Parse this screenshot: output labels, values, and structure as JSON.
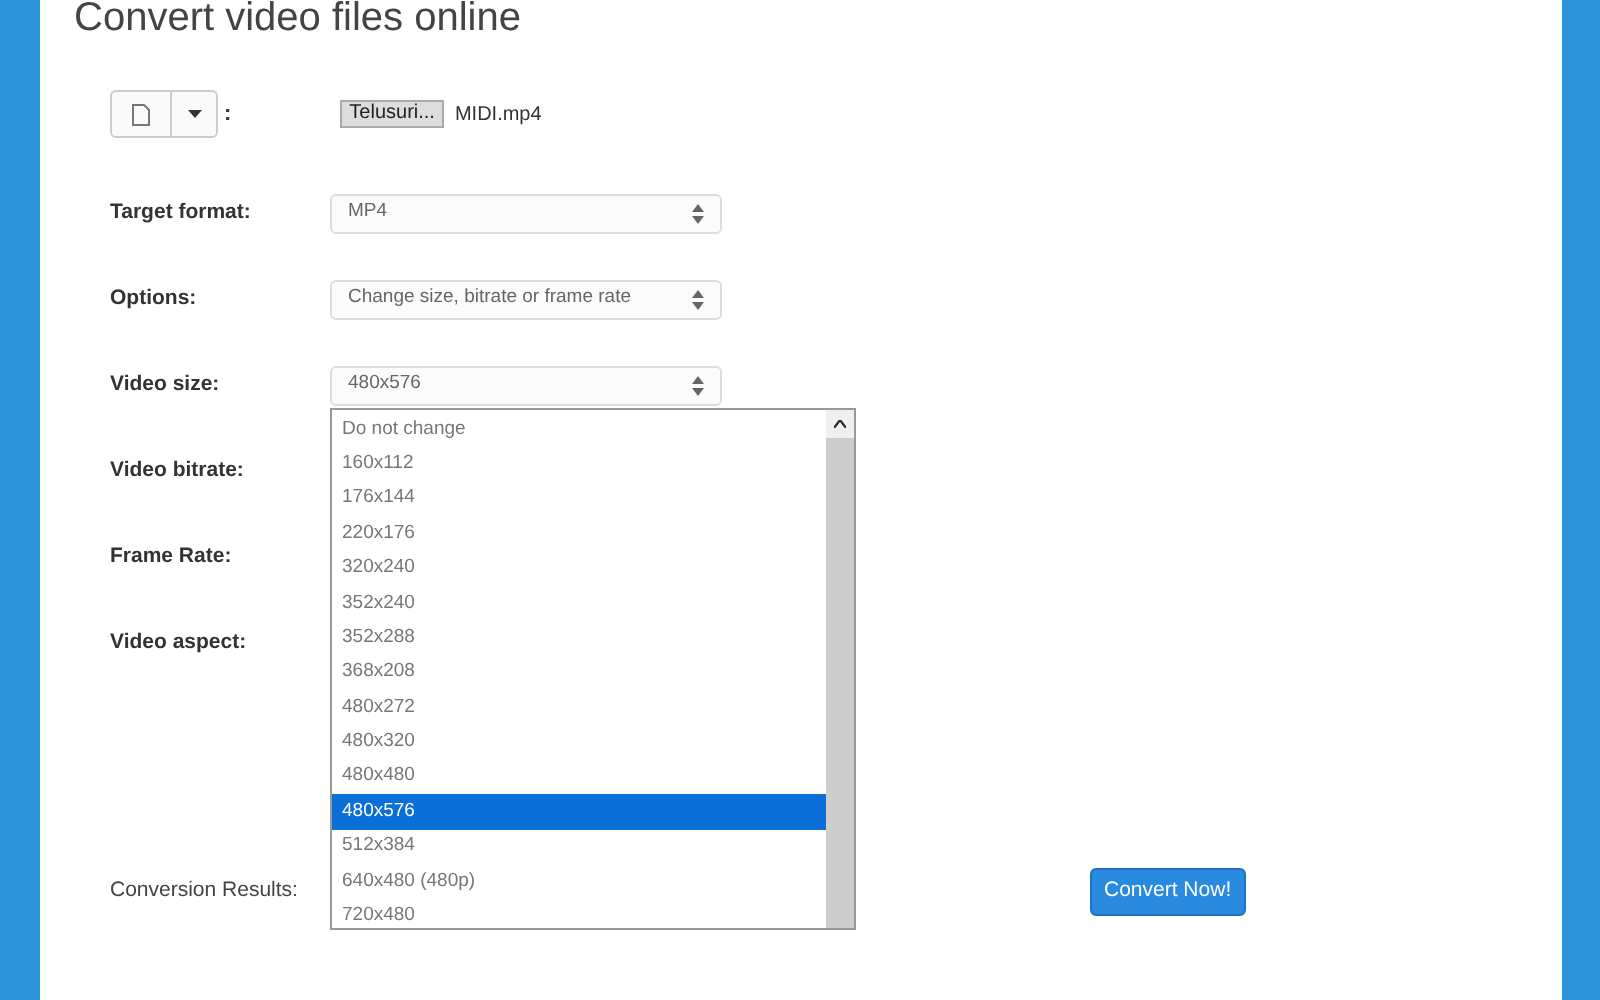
{
  "title": "Convert video files online",
  "file_row": {
    "colon": ":",
    "browse_button": "Telusuri...",
    "file_name": "MIDI.mp4"
  },
  "fields": [
    {
      "label": "Target format:",
      "value": "MP4"
    },
    {
      "label": "Options:",
      "value": "Change size, bitrate or frame rate"
    },
    {
      "label": "Video size:",
      "value": "480x576"
    },
    {
      "label": "Video bitrate:"
    },
    {
      "label": "Frame Rate:"
    },
    {
      "label": "Video aspect:"
    }
  ],
  "dropdown": {
    "items": [
      {
        "label": "Do not change",
        "selected": false
      },
      {
        "label": "160x112",
        "selected": false
      },
      {
        "label": "176x144",
        "selected": false
      },
      {
        "label": "220x176",
        "selected": false
      },
      {
        "label": "320x240",
        "selected": false
      },
      {
        "label": "352x240",
        "selected": false
      },
      {
        "label": "352x288",
        "selected": false
      },
      {
        "label": "368x208",
        "selected": false
      },
      {
        "label": "480x272",
        "selected": false
      },
      {
        "label": "480x320",
        "selected": false
      },
      {
        "label": "480x480",
        "selected": false
      },
      {
        "label": "480x576",
        "selected": true
      },
      {
        "label": "512x384",
        "selected": false
      },
      {
        "label": "640x480 (480p)",
        "selected": false
      },
      {
        "label": "720x480",
        "selected": false
      }
    ]
  },
  "results_label": "Conversion Results:",
  "convert_button": "Convert Now!"
}
